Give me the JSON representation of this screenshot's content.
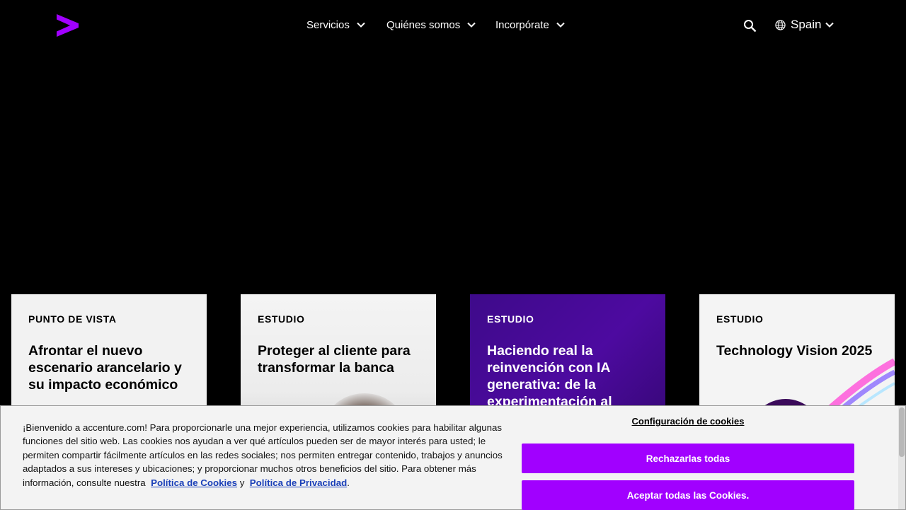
{
  "header": {
    "nav": [
      {
        "label": "Servicios"
      },
      {
        "label": "Quiénes somos"
      },
      {
        "label": "Incorpórate"
      }
    ],
    "country": "Spain",
    "brand_color": "#a100ff"
  },
  "cards": [
    {
      "category": "PUNTO DE VISTA",
      "title": "Afrontar el nuevo escenario arancelario y su impacto económico"
    },
    {
      "category": "ESTUDIO",
      "title": "Proteger al cliente para transformar la banca"
    },
    {
      "category": "ESTUDIO",
      "title": "Haciendo real la reinvención con IA generativa: de la experimentación al"
    },
    {
      "category": "ESTUDIO",
      "title": "Technology Vision 2025"
    }
  ],
  "cookie_banner": {
    "text": "¡Bienvenido a accenture.com! Para proporcionarle una mejor experiencia, utilizamos cookies para habilitar algunas funciones del sitio web. Las cookies nos ayudan a ver qué artículos pueden ser de mayor interés para usted; le permiten compartir fácilmente artículos en las redes sociales; nos permiten entregar contenido, trabajos y anuncios adaptados a sus intereses y ubicaciones; y proporcionar muchos otros beneficios del sitio. Para obtener más información, consulte nuestra",
    "cookie_policy_link": "Política de Cookies",
    "connector": "y",
    "privacy_policy_link": "Política de Privacidad",
    "end": ".",
    "settings_label": "Configuración de cookies",
    "reject_label": "Rechazarlas todas",
    "accept_label": "Aceptar todas las Cookies."
  }
}
